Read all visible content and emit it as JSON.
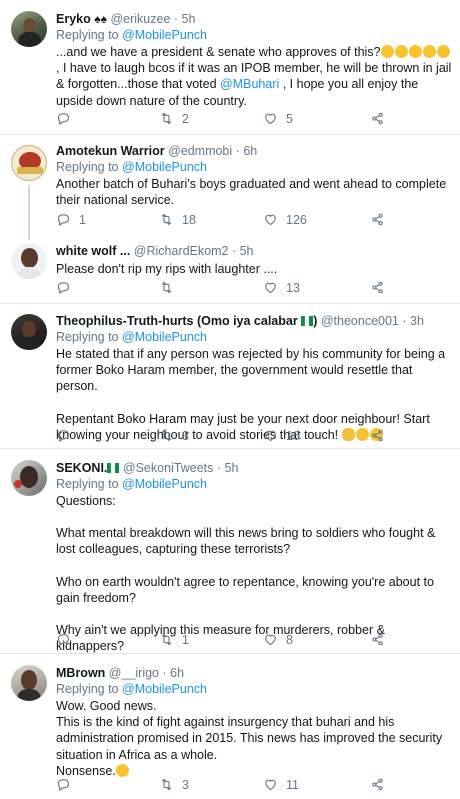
{
  "tweets": [
    {
      "name": "Eryko",
      "handle": "@erikuzee",
      "dot": "·",
      "time": "5h",
      "text": [
        "...and we have a president & senate who approves of this?",
        ", I have to laugh bcos if it was an IPOB member, he will be thrown in jail & forgotten...those that voted ",
        "@MBuhari",
        " , I hope you all enjoy the upside down nature of the country."
      ],
      "reply_count": "",
      "retweet_count": "2",
      "like_count": "5"
    },
    {
      "name": "Amotekun Warrior",
      "handle": "@edmmobi",
      "dot": "·",
      "time": "6h",
      "replying_prefix": "Replying to ",
      "replying_to": "@MobilePunch",
      "text": "Another batch of Buhari's boys graduated and went ahead to complete their national service.",
      "reply_count": "1",
      "retweet_count": "18",
      "like_count": "126"
    },
    {
      "name": "white wolf ...",
      "handle": "@RichardEkom2",
      "dot": "·",
      "time": "5h",
      "text": "Please don't rip my rips with laughter ....",
      "reply_count": "",
      "retweet_count": "",
      "like_count": "13"
    },
    {
      "name": "Theophilus-Truth-hurts (Omo iya calabar",
      "name_suffix": ")",
      "handle": "@theonce001",
      "dot": "·",
      "time": "3h",
      "replying_prefix": "Replying to ",
      "replying_to": "@MobilePunch",
      "text_p1": "He stated that if any person was rejected by his community for being a former Boko Haram member, the government would resettle that person.",
      "text_p2": "Repentant Boko Haram may just be your next door neighbour!  Start knowing your neighbour to avoid stories that touch!",
      "reply_count": "",
      "retweet_count": "3",
      "like_count": "16"
    },
    {
      "name": "SEKONI.",
      "handle": "@SekoniTweets",
      "dot": "·",
      "time": "5h",
      "replying_prefix": "Replying to ",
      "replying_to": "@MobilePunch",
      "text_p1": "Questions:",
      "text_p2": "What mental breakdown will this news bring to soldiers who fought & lost colleagues, capturing these terrorists?",
      "text_p3": "Who on earth wouldn't agree to repentance, knowing you're about to gain freedom?",
      "text_p4": "Why ain't we applying this measure for murderers, robber & kidnappers?",
      "reply_count": "",
      "retweet_count": "1",
      "like_count": "8"
    },
    {
      "name": "MBrown",
      "handle": "@__irigo",
      "dot": "·",
      "time": "6h",
      "replying_prefix": "Replying to ",
      "replying_to": "@MobilePunch",
      "text_l1": "Wow. Good news.",
      "text_l2": "This is the kind of fight against insurgency that buhari and his administration promised in 2015. This news has improved the security situation in Africa as a whole.",
      "text_l3": "Nonsense.",
      "reply_count": "",
      "retweet_count": "3",
      "like_count": "11"
    }
  ],
  "top_reply": {
    "prefix": "Replying to ",
    "mention": "@MobilePunch"
  },
  "colors": {
    "link": "#1b95e0",
    "muted": "#657786",
    "separator": "#e1e8ed",
    "thread_line": "#ccd6dd"
  },
  "icons": [
    "reply-icon",
    "retweet-icon",
    "like-icon",
    "share-icon"
  ]
}
